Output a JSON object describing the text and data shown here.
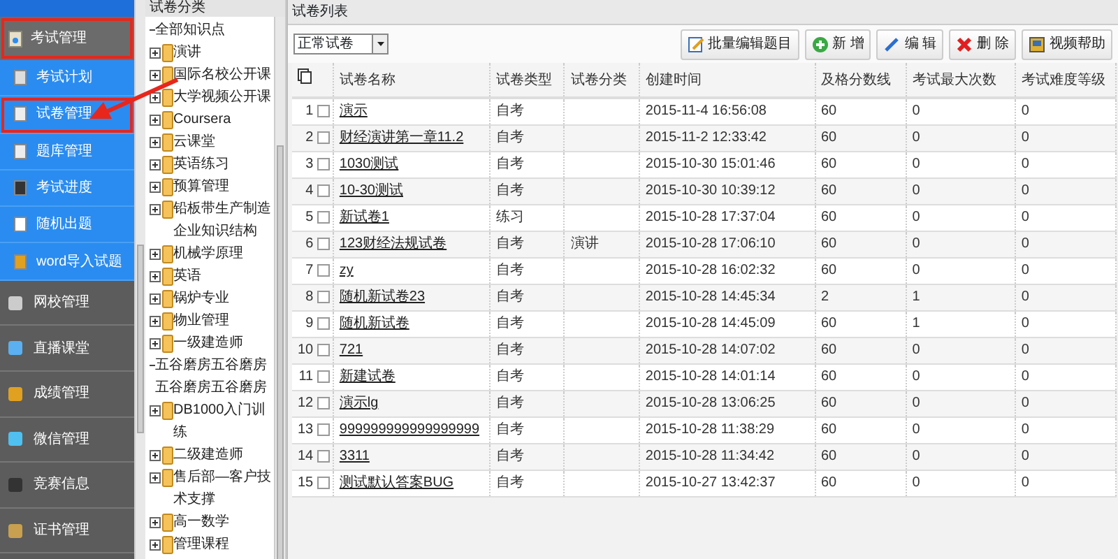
{
  "sidebar": {
    "header": {
      "label": "考试管理",
      "highlighted": true
    },
    "sub_items": [
      {
        "label": "考试计划",
        "highlighted": false
      },
      {
        "label": "试卷管理",
        "highlighted": true
      },
      {
        "label": "题库管理",
        "highlighted": false
      },
      {
        "label": "考试进度",
        "highlighted": false
      },
      {
        "label": "随机出题",
        "highlighted": false
      },
      {
        "label": "word导入试题",
        "highlighted": false
      }
    ],
    "items": [
      "网校管理",
      "直播课堂",
      "成绩管理",
      "微信管理",
      "竞赛信息",
      "证书管理"
    ]
  },
  "tree": {
    "title": "试卷分类",
    "items": [
      {
        "label": "全部知识点",
        "kind": "leaf"
      },
      {
        "label": "演讲",
        "kind": "folder"
      },
      {
        "label": "国际名校公开课",
        "kind": "folder"
      },
      {
        "label": "大学视频公开课",
        "kind": "folder"
      },
      {
        "label": "Coursera",
        "kind": "folder"
      },
      {
        "label": "云课堂",
        "kind": "folder"
      },
      {
        "label": "英语练习",
        "kind": "folder"
      },
      {
        "label": "预算管理",
        "kind": "folder"
      },
      {
        "label": "铅板带生产制造企业知识结构",
        "kind": "folder"
      },
      {
        "label": "机械学原理",
        "kind": "folder"
      },
      {
        "label": "英语",
        "kind": "folder"
      },
      {
        "label": "锅炉专业",
        "kind": "folder"
      },
      {
        "label": "物业管理",
        "kind": "folder"
      },
      {
        "label": "一级建造师",
        "kind": "folder"
      },
      {
        "label": "五谷磨房五谷磨房五谷磨房五谷磨房",
        "kind": "leaf"
      },
      {
        "label": "DB1000入门训练",
        "kind": "folder"
      },
      {
        "label": "二级建造师",
        "kind": "folder"
      },
      {
        "label": "售后部—客户技术支撑",
        "kind": "folder"
      },
      {
        "label": "高一数学",
        "kind": "folder"
      },
      {
        "label": "管理课程",
        "kind": "folder"
      }
    ]
  },
  "panel": {
    "title": "试卷列表",
    "filter": "正常试卷",
    "buttons": [
      {
        "label": "批量编辑题目",
        "kind": "batch"
      },
      {
        "label": "新 增",
        "kind": "add"
      },
      {
        "label": "编 辑",
        "kind": "edit"
      },
      {
        "label": "删 除",
        "kind": "delete"
      },
      {
        "label": "视频帮助",
        "kind": "help"
      }
    ],
    "columns": [
      "试卷名称",
      "试卷类型",
      "试卷分类",
      "创建时间",
      "及格分数线",
      "考试最大次数",
      "考试难度等级"
    ],
    "rows": [
      {
        "index": "1",
        "checked": false,
        "cells": [
          "演示",
          "自考",
          "",
          "2015-11-4 16:56:08",
          "60",
          "0",
          "0"
        ]
      },
      {
        "index": "2",
        "checked": false,
        "cells": [
          "财经演讲第一章11.2",
          "自考",
          "",
          "2015-11-2 12:33:42",
          "60",
          "0",
          "0"
        ]
      },
      {
        "index": "3",
        "checked": false,
        "cells": [
          "1030测试",
          "自考",
          "",
          "2015-10-30 15:01:46",
          "60",
          "0",
          "0"
        ]
      },
      {
        "index": "4",
        "checked": false,
        "cells": [
          "10-30测试",
          "自考",
          "",
          "2015-10-30 10:39:12",
          "60",
          "0",
          "0"
        ]
      },
      {
        "index": "5",
        "checked": false,
        "cells": [
          "新试卷1",
          "练习",
          "",
          "2015-10-28 17:37:04",
          "60",
          "0",
          "0"
        ]
      },
      {
        "index": "6",
        "checked": false,
        "cells": [
          "123财经法规试卷",
          "自考",
          "演讲",
          "2015-10-28 17:06:10",
          "60",
          "0",
          "0"
        ]
      },
      {
        "index": "7",
        "checked": false,
        "cells": [
          "zy",
          "自考",
          "",
          "2015-10-28 16:02:32",
          "60",
          "0",
          "0"
        ]
      },
      {
        "index": "8",
        "checked": false,
        "cells": [
          "随机新试卷23",
          "自考",
          "",
          "2015-10-28 14:45:34",
          "2",
          "1",
          "0"
        ]
      },
      {
        "index": "9",
        "checked": false,
        "cells": [
          "随机新试卷",
          "自考",
          "",
          "2015-10-28 14:45:09",
          "60",
          "1",
          "0"
        ]
      },
      {
        "index": "10",
        "checked": false,
        "cells": [
          "721",
          "自考",
          "",
          "2015-10-28 14:07:02",
          "60",
          "0",
          "0"
        ]
      },
      {
        "index": "11",
        "checked": false,
        "cells": [
          "新建试卷",
          "自考",
          "",
          "2015-10-28 14:01:14",
          "60",
          "0",
          "0"
        ]
      },
      {
        "index": "12",
        "checked": false,
        "cells": [
          "演示lg",
          "自考",
          "",
          "2015-10-28 13:06:25",
          "60",
          "0",
          "0"
        ]
      },
      {
        "index": "13",
        "checked": false,
        "cells": [
          "999999999999999999",
          "自考",
          "",
          "2015-10-28 11:38:29",
          "60",
          "0",
          "0"
        ]
      },
      {
        "index": "14",
        "checked": false,
        "cells": [
          "3311",
          "自考",
          "",
          "2015-10-28 11:34:42",
          "60",
          "0",
          "0"
        ]
      },
      {
        "index": "15",
        "checked": false,
        "cells": [
          "测试默认答案BUG",
          "自考",
          "",
          "2015-10-27 13:42:37",
          "60",
          "0",
          "0"
        ]
      }
    ]
  }
}
